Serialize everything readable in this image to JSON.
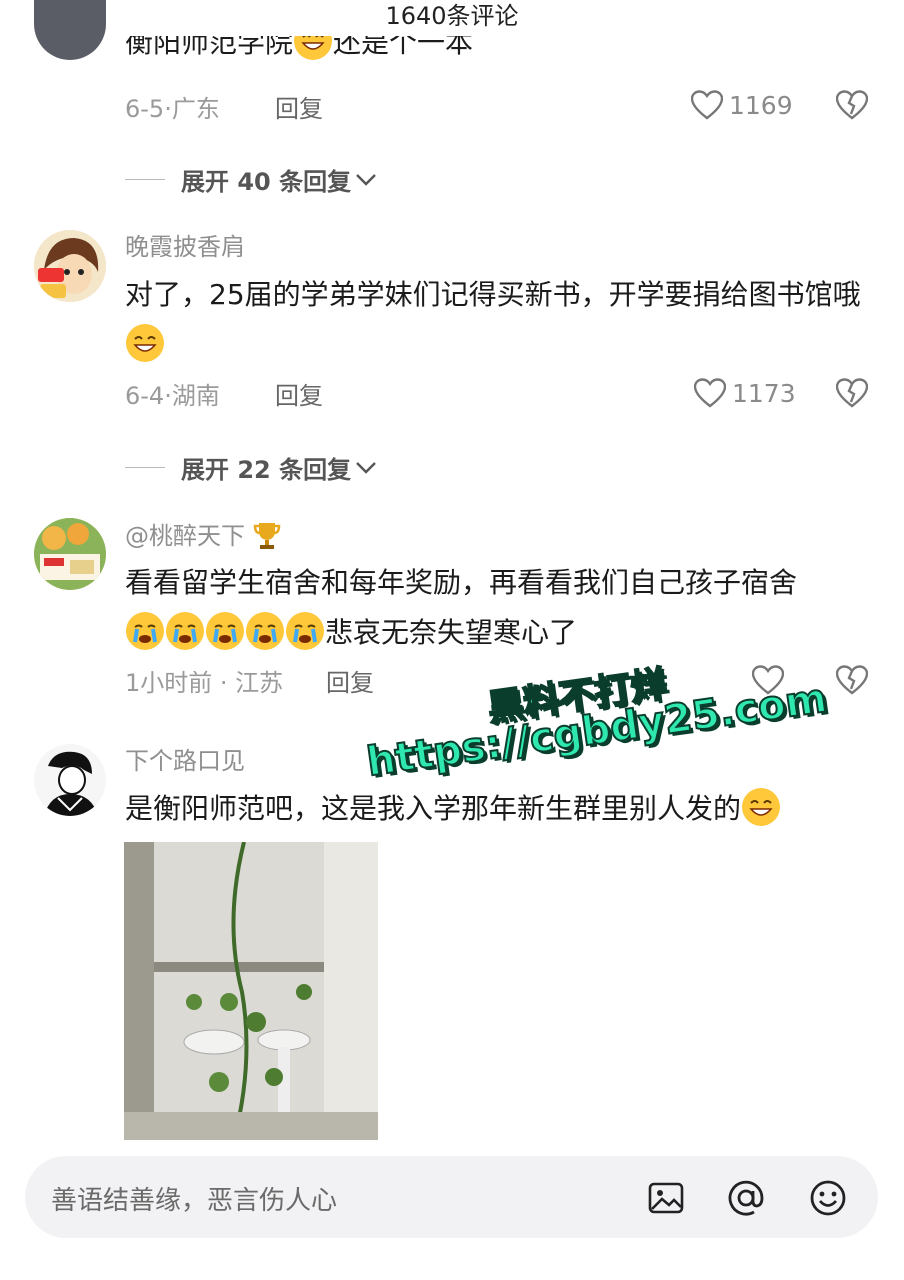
{
  "header": {
    "title": "1640条评论"
  },
  "comments": [
    {
      "text_partial": "衡阳师范学院",
      "text_partial_tail": "还是个一本",
      "date": "6-5",
      "location": "广东",
      "reply_label": "回复",
      "likes": "1169",
      "expand_label": "展开 40 条回复"
    },
    {
      "username": "晚霞披香肩",
      "text": "对了，25届的学弟学妹们记得买新书，开学要捐给图书馆哦",
      "date": "6-4",
      "location": "湖南",
      "reply_label": "回复",
      "likes": "1173",
      "expand_label": "展开 22 条回复"
    },
    {
      "username": "@桃醉天下",
      "text_line1": "看看留学生宿舍和每年奖励，再看看我们自己孩子宿舍",
      "text_line2_tail": "悲哀无奈失望寒心了",
      "date": "1小时前",
      "location": "江苏",
      "reply_label": "回复"
    },
    {
      "username": "下个路口见",
      "text": "是衡阳师范吧，这是我入学那年新生群里别人发的"
    }
  ],
  "watermark": {
    "line1": "黑料不打烊",
    "line2": "https://cgbdy25.com"
  },
  "input": {
    "placeholder": "善语结善缘，恶言伤人心"
  },
  "icons": [
    "image-icon",
    "at-icon",
    "emoji-icon",
    "heart-icon",
    "dislike-heart-icon",
    "chevron-down-icon",
    "trophy-icon"
  ],
  "colors": {
    "watermark": "#2ee8b0",
    "muted": "#9a9a9a"
  }
}
